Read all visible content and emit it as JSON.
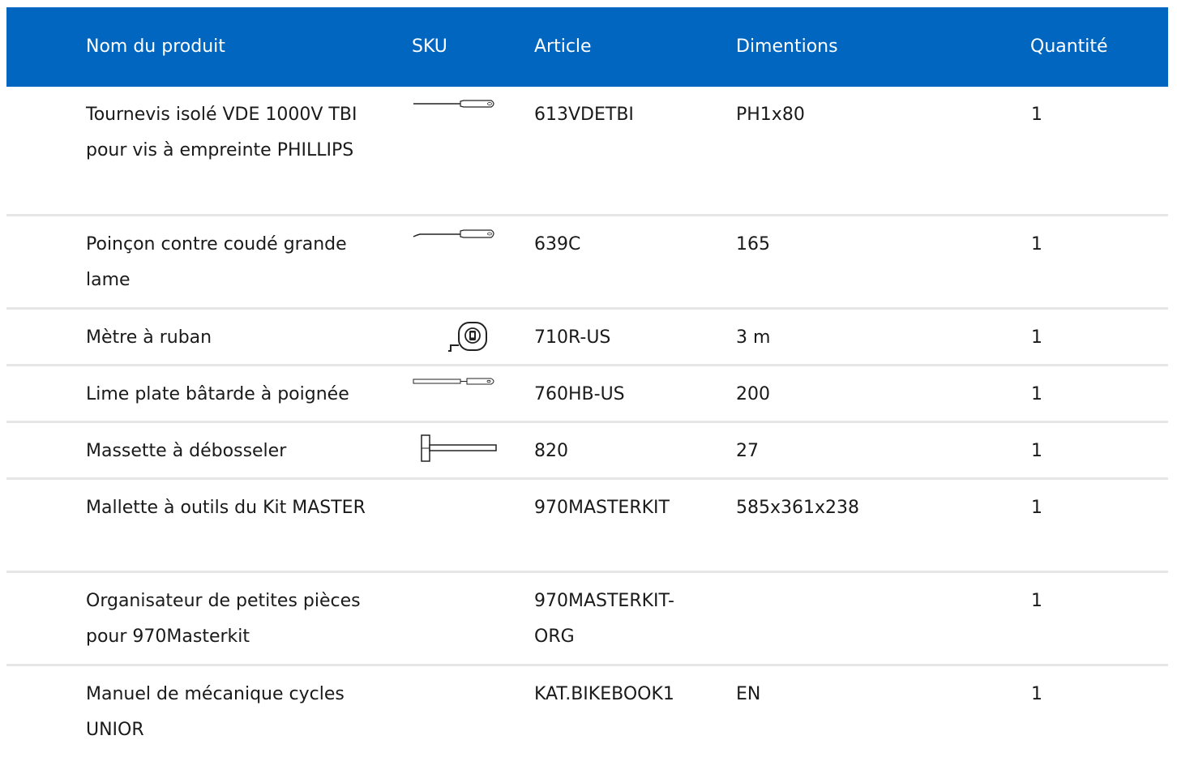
{
  "colors": {
    "header_bg": "#0066bf",
    "header_text": "#ffffff",
    "divider": "#e6e6e6",
    "text": "#1a1a1a"
  },
  "table": {
    "headers": {
      "name": "Nom du produit",
      "sku": "SKU",
      "article": "Article",
      "dimensions": "Dimentions",
      "quantity": "Quantité"
    },
    "rows": [
      {
        "name": "Tournevis isolé VDE 1000V TBI pour vis à empreinte PHILLIPS",
        "sku_icon": "screwdriver-icon",
        "article": "613VDETBI",
        "dimensions": "PH1x80",
        "quantity": "1"
      },
      {
        "name": "Poinçon contre coudé grande lame",
        "sku_icon": "bent-awl-icon",
        "article": "639C",
        "dimensions": "165",
        "quantity": "1"
      },
      {
        "name": "Mètre à ruban",
        "sku_icon": "tape-measure-icon",
        "article": "710R-US",
        "dimensions": "3 m",
        "quantity": "1"
      },
      {
        "name": "Lime plate bâtarde à poignée",
        "sku_icon": "flat-file-icon",
        "article": "760HB-US",
        "dimensions": "200",
        "quantity": "1"
      },
      {
        "name": "Massette à débosseler",
        "sku_icon": "hammer-icon",
        "article": "820",
        "dimensions": "27",
        "quantity": "1"
      },
      {
        "name": "Mallette à outils du Kit MASTER",
        "sku_icon": "",
        "article": "970MASTERKIT",
        "dimensions": "585x361x238",
        "quantity": "1"
      },
      {
        "name": "Organisateur de petites pièces pour 970Masterkit",
        "sku_icon": "",
        "article": "970MASTERKIT-ORG",
        "dimensions": "",
        "quantity": "1"
      },
      {
        "name": "Manuel de mécanique cycles UNIOR",
        "sku_icon": "",
        "article": "KAT.BIKEBOOK1",
        "dimensions": "EN",
        "quantity": "1"
      }
    ]
  }
}
